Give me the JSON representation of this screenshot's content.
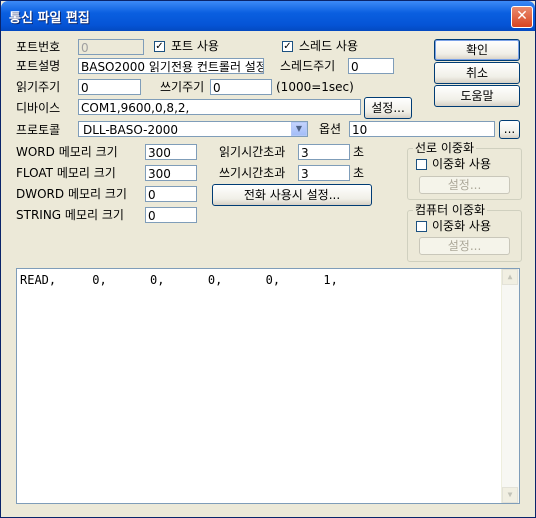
{
  "window": {
    "title": "통신 파일 편집",
    "close_glyph": "✕"
  },
  "row1": {
    "port_no_label": "포트번호",
    "port_no_value": "0",
    "port_use_label": "포트 사용",
    "port_use_checked": true,
    "thread_use_label": "스레드 사용",
    "thread_use_checked": true
  },
  "row2": {
    "port_desc_label": "포트설명",
    "port_desc_value": "BASO2000 읽기전용 컨트롤러 설정",
    "thread_period_label": "스레드주기",
    "thread_period_value": "0"
  },
  "row3": {
    "read_period_label": "읽기주기",
    "read_period_value": "0",
    "write_period_label": "쓰기주기",
    "write_period_value": "0",
    "unit_note": "(1000=1sec)"
  },
  "row4": {
    "device_label": "디바이스",
    "device_value": "COM1,9600,0,8,2,",
    "settings_button": "설정..."
  },
  "row5": {
    "protocol_label": "프로토콜",
    "protocol_value": "DLL-BASO-2000",
    "option_label": "옵션",
    "option_value": "10",
    "option_button": "..."
  },
  "memory": {
    "word_label": "WORD 메모리 크기",
    "word_value": "300",
    "float_label": "FLOAT 메모리 크기",
    "float_value": "300",
    "dword_label": "DWORD 메모리 크기",
    "dword_value": "0",
    "string_label": "STRING 메모리 크기",
    "string_value": "0"
  },
  "timeouts": {
    "read_timeout_label": "읽기시간초과",
    "read_timeout_value": "3",
    "read_timeout_unit": "초",
    "write_timeout_label": "쓰기시간초과",
    "write_timeout_value": "3",
    "write_timeout_unit": "초",
    "phone_settings_button": "전화 사용시 설정..."
  },
  "buttons": {
    "ok": "확인",
    "cancel": "취소",
    "help": "도움말"
  },
  "line_redundancy": {
    "title": "선로 이중화",
    "use_label": "이중화 사용",
    "use_checked": false,
    "settings_button": "설정..."
  },
  "pc_redundancy": {
    "title": "컴퓨터 이중화",
    "use_label": "이중화 사용",
    "use_checked": false,
    "settings_button": "설정..."
  },
  "editor": {
    "text": "READ,     0,      0,      0,      0,      1,"
  },
  "colors": {
    "titlebar": "#0554d6",
    "dialog_bg": "#ece9d8",
    "field_border": "#7f9db9",
    "close_button": "#d8431f"
  }
}
